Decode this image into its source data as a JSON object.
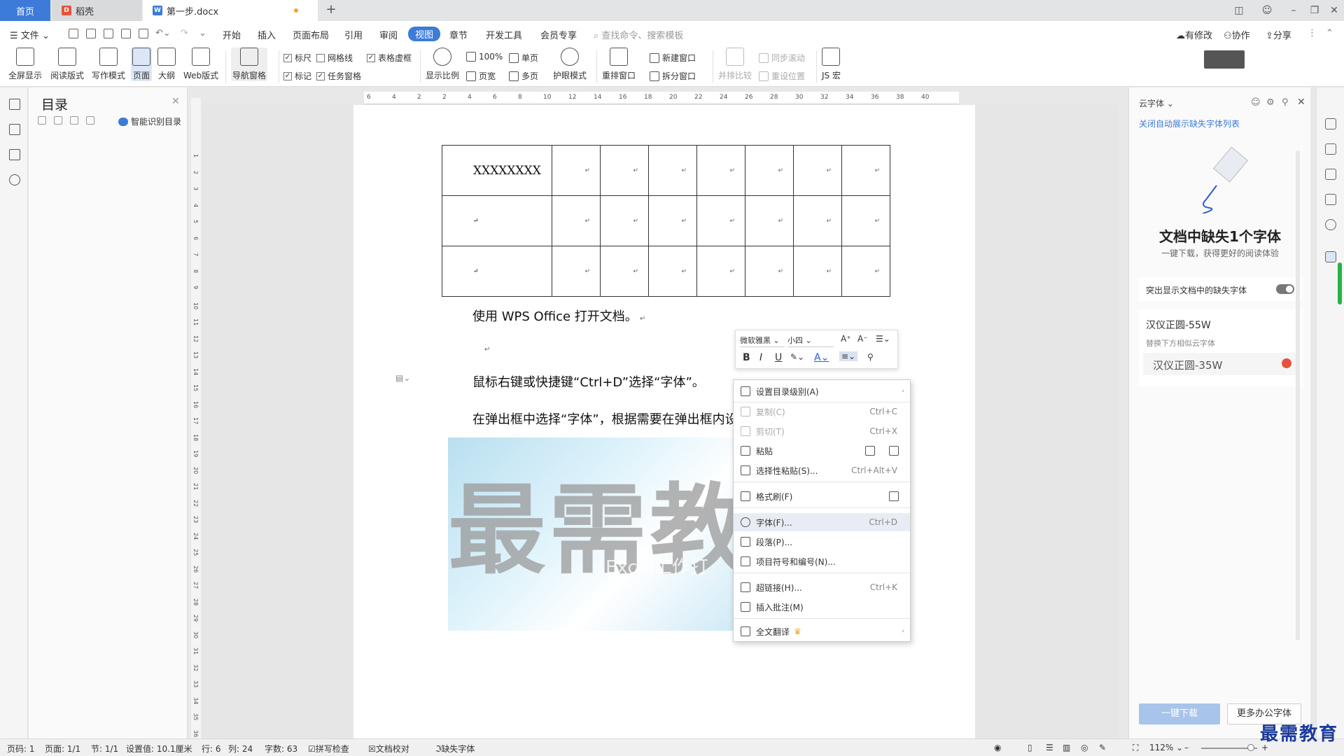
{
  "titlebar": {
    "tabs": [
      {
        "label": "首页"
      },
      {
        "label": "稻壳"
      },
      {
        "label": "第一步.docx"
      }
    ]
  },
  "menu": {
    "file": "文件",
    "items": [
      "开始",
      "插入",
      "页面布局",
      "引用",
      "审阅",
      "视图",
      "章节",
      "开发工具",
      "会员专享"
    ],
    "search_placeholder": "查找命令、搜索模板",
    "right": [
      "有修改",
      "协作",
      "分享"
    ]
  },
  "ribbon": {
    "buttons": [
      "全屏显示",
      "阅读版式",
      "写作模式",
      "页面",
      "大纲",
      "Web版式",
      "导航窗格"
    ],
    "checks": [
      {
        "label": "标尺",
        "checked": true
      },
      {
        "label": "网格线",
        "checked": false
      },
      {
        "label": "表格虚框",
        "checked": true
      },
      {
        "label": "标记",
        "checked": true
      },
      {
        "label": "任务窗格",
        "checked": true
      }
    ],
    "zoom": [
      "显示比例",
      "100%",
      "页宽",
      "单页",
      "多页"
    ],
    "eye": "护眼模式",
    "windows": [
      "重排窗口",
      "新建窗口",
      "拆分窗口"
    ],
    "compare": [
      "并排比较",
      "同步滚动",
      "重设位置"
    ],
    "js": "JS 宏"
  },
  "toc": {
    "title": "目录",
    "smart": "智能识别目录"
  },
  "ruler": {
    "h": [
      "6",
      "4",
      "2",
      "2",
      "4",
      "6",
      "8",
      "10",
      "12",
      "14",
      "16",
      "18",
      "20",
      "22",
      "24",
      "26",
      "28",
      "30",
      "32",
      "34",
      "36",
      "38",
      "40"
    ],
    "v": [
      "1",
      "2",
      "3",
      "4",
      "5",
      "6",
      "7",
      "8",
      "9",
      "10",
      "11",
      "12",
      "13",
      "14",
      "15",
      "16",
      "17",
      "18",
      "19",
      "20",
      "21",
      "22",
      "23",
      "24",
      "25",
      "26",
      "27",
      "28",
      "29",
      "30",
      "31",
      "32",
      "33",
      "34",
      "35",
      "36"
    ]
  },
  "document": {
    "table_first_cell": "XXXXXXXX",
    "para1": "使用 WPS Office 打开文档。",
    "para2": "鼠标右键或快捷键“Ctrl+D”选择“字体”。",
    "para3": "在弹出框中选择“字体”，根据需要在弹出框内设",
    "watermark": "最需教",
    "watermark_sub": "Excel工作打"
  },
  "minitoolbar": {
    "font": "微软雅黑",
    "size": "小四"
  },
  "context_menu": [
    {
      "label": "设置目录级别(A)",
      "shortcut": "",
      "disabled": false,
      "arrow": true
    },
    {
      "label": "复制(C)",
      "shortcut": "Ctrl+C",
      "disabled": true
    },
    {
      "label": "剪切(T)",
      "shortcut": "Ctrl+X",
      "disabled": true
    },
    {
      "label": "粘贴",
      "shortcut": "",
      "disabled": false
    },
    {
      "label": "选择性粘贴(S)...",
      "shortcut": "Ctrl+Alt+V",
      "disabled": false
    },
    {
      "label": "格式刷(F)",
      "shortcut": "",
      "disabled": false
    },
    {
      "label": "字体(F)...",
      "shortcut": "Ctrl+D",
      "disabled": false,
      "hover": true
    },
    {
      "label": "段落(P)...",
      "shortcut": "",
      "disabled": false
    },
    {
      "label": "项目符号和编号(N)...",
      "shortcut": "",
      "disabled": false
    },
    {
      "label": "超链接(H)...",
      "shortcut": "Ctrl+K",
      "disabled": false
    },
    {
      "label": "插入批注(M)",
      "shortcut": "",
      "disabled": false
    },
    {
      "label": "全文翻译",
      "shortcut": "",
      "disabled": false,
      "arrow": true
    }
  ],
  "rightpanel": {
    "title": "云字体",
    "link": "关闭自动展示缺失字体列表",
    "heading": "文档中缺失1个字体",
    "sub": "一键下载，获得更好的阅读体验",
    "toggle_label": "突出显示文档中的缺失字体",
    "missing_font": "汉仪正圆-55W",
    "replace_hint": "替换下方相似云字体",
    "similar_font": "汉仪正圆-35W",
    "download": "一键下载",
    "more": "更多办公字体"
  },
  "statusbar": {
    "items": [
      "页码: 1",
      "页面: 1/1",
      "节: 1/1",
      "设置值: 10.1厘米",
      "行: 6",
      "列: 24",
      "字数: 63",
      "拼写检查",
      "文档校对",
      "缺失字体"
    ],
    "zoom": "112%",
    "brand": "最需教育"
  }
}
